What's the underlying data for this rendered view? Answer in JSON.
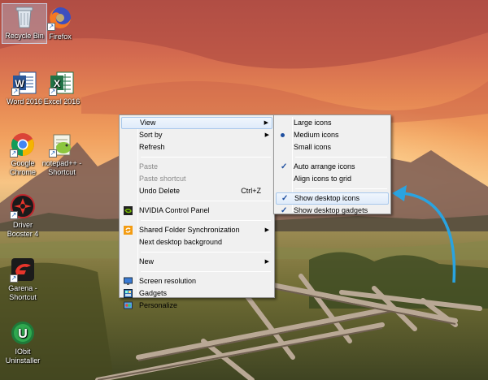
{
  "desktop": {
    "icons": [
      {
        "label": "Recycle Bin",
        "icon": "recycle-bin-icon"
      },
      {
        "label": "Firefox",
        "icon": "firefox-icon"
      },
      {
        "label": "Word 2016",
        "icon": "word-icon"
      },
      {
        "label": "Excel 2016",
        "icon": "excel-icon"
      },
      {
        "label": "Google Chrome",
        "icon": "chrome-icon"
      },
      {
        "label": "notepad++ - Shortcut",
        "icon": "notepad-plus-plus-icon"
      },
      {
        "label": "Driver Booster 4",
        "icon": "driver-booster-icon"
      },
      {
        "label": "Garena - Shortcut",
        "icon": "garena-icon"
      },
      {
        "label": "IObit Uninstaller",
        "icon": "iobit-uninstaller-icon"
      }
    ]
  },
  "context_menu": {
    "items": [
      {
        "label": "View",
        "submenu": true
      },
      {
        "label": "Sort by",
        "submenu": true
      },
      {
        "label": "Refresh"
      },
      {
        "label": "Paste",
        "disabled": true
      },
      {
        "label": "Paste shortcut",
        "disabled": true
      },
      {
        "label": "Undo Delete",
        "accel": "Ctrl+Z"
      },
      {
        "label": "NVIDIA Control Panel",
        "icon": "nvidia-icon"
      },
      {
        "label": "Shared Folder Synchronization",
        "icon": "sync-icon",
        "submenu": true
      },
      {
        "label": "Next desktop background"
      },
      {
        "label": "New",
        "submenu": true
      },
      {
        "label": "Screen resolution",
        "icon": "display-icon"
      },
      {
        "label": "Gadgets",
        "icon": "gadgets-icon"
      },
      {
        "label": "Personalize",
        "icon": "personalize-icon"
      }
    ]
  },
  "view_submenu": {
    "items": [
      {
        "label": "Large icons"
      },
      {
        "label": "Medium icons",
        "selected": true
      },
      {
        "label": "Small icons"
      },
      {
        "label": "Auto arrange icons",
        "checked": true
      },
      {
        "label": "Align icons to grid"
      },
      {
        "label": "Show desktop icons",
        "checked": true
      },
      {
        "label": "Show desktop gadgets",
        "checked": true
      }
    ]
  },
  "symbols": {
    "submenu_arrow": "▶",
    "check": "✓",
    "shortcut_arrow": "↗"
  },
  "colors": {
    "annotation_arrow": "#2aa3e0",
    "menu_background": "#f0f0f0",
    "menu_highlight": "#dfebfa"
  }
}
